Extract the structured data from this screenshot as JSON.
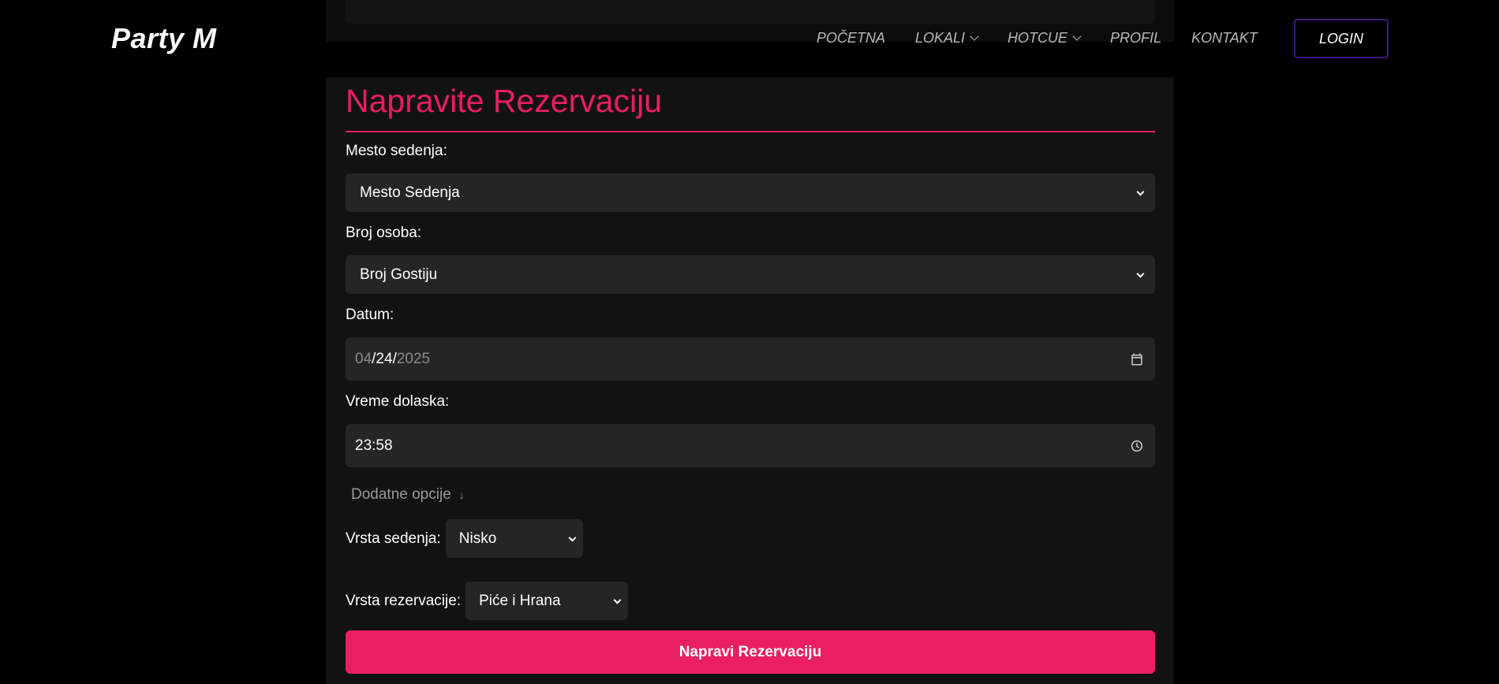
{
  "header": {
    "logo": "Party M",
    "nav": [
      {
        "label": "POČETNA",
        "dropdown": false
      },
      {
        "label": "LOKALI",
        "dropdown": true
      },
      {
        "label": "HOTCUE",
        "dropdown": true
      },
      {
        "label": "PROFIL",
        "dropdown": false
      },
      {
        "label": "KONTAKT",
        "dropdown": false
      }
    ],
    "login_label": "LOGIN"
  },
  "form": {
    "title": "Napravite Rezervaciju",
    "seat_label": "Mesto sedenja:",
    "seat_value": "Mesto Sedenja",
    "guests_label": "Broj osoba:",
    "guests_value": "Broj Gostiju",
    "date_label": "Datum:",
    "date_month": "04",
    "date_day": "24",
    "date_year": "2025",
    "date_sep": "/",
    "time_label": "Vreme dolaska:",
    "time_value": "23:58",
    "extra_options": "Dodatne opcije",
    "seating_type_label": "Vrsta sedenja:",
    "seating_type_value": "Nisko",
    "reservation_type_label": "Vrsta rezervacije:",
    "reservation_type_value": "Piće i Hrana",
    "submit_label": "Napravi Rezervaciju"
  },
  "colors": {
    "accent": "#e91e63",
    "background": "#000000",
    "card": "#121212",
    "input": "#252525",
    "login_border": "#3c1a7a"
  },
  "icons": {
    "date": "calendar-icon",
    "time": "clock-icon",
    "extra": "arrow-down-icon",
    "select": "chevron-down-icon"
  }
}
